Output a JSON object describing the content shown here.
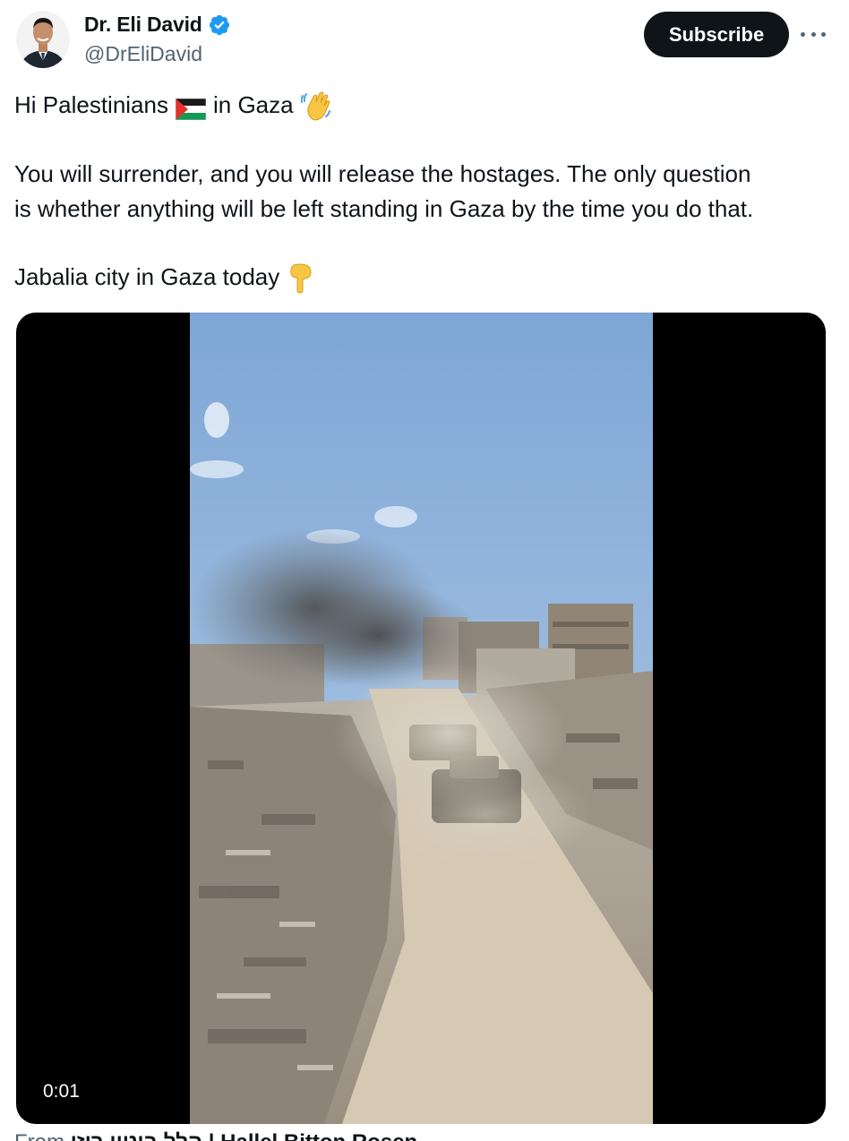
{
  "author": {
    "name": "Dr. Eli David",
    "handle": "@DrEliDavid",
    "verified": true
  },
  "actions": {
    "subscribe_label": "Subscribe",
    "more_icon": "more-horizontal-icon"
  },
  "post": {
    "line1_a": "Hi Palestinians",
    "line1_b": "in Gaza",
    "line2": "You will surrender, and you will release the hostages. The only question",
    "line3": "is whether anything will be left standing in Gaza by the time you do that.",
    "line4": "Jabalia city in Gaza today",
    "emojis": [
      "palestine-flag",
      "waving-hand",
      "pointing-down"
    ]
  },
  "media": {
    "type": "video",
    "timestamp": "0:01"
  },
  "footer": {
    "prefix": "From ",
    "source": "הלל ביטון רוזן | Hallel Bitton Rosen"
  },
  "colors": {
    "text": "#0f1419",
    "secondary": "#536471",
    "verified": "#1d9bf0",
    "button_bg": "#0f1419"
  }
}
